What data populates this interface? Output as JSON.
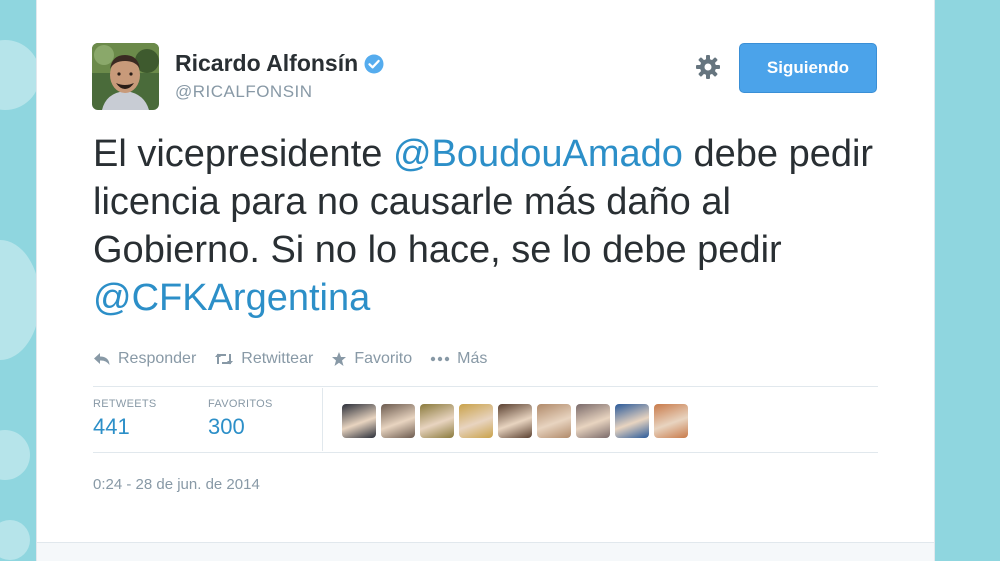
{
  "theme": {
    "accent": "#2c8fc8",
    "follow_button": "#4ba3ea",
    "background": "#8fd6df"
  },
  "tweet": {
    "author_name": "Ricardo Alfonsín",
    "author_handle": "@RICALFONSIN",
    "verified_icon": "verified-badge-icon",
    "settings_icon": "gear-icon",
    "follow_label": "Siguiendo",
    "text_parts": [
      "El vicepresidente ",
      "@BoudouAmado",
      " debe pedir licencia para no causarle más daño al Gobierno. Si no lo hace, se lo debe pedir ",
      "@CFKArgentina"
    ],
    "actions": [
      {
        "label": "Responder",
        "icon": "reply-icon"
      },
      {
        "label": "Retwittear",
        "icon": "retweet-icon"
      },
      {
        "label": "Favorito",
        "icon": "star-icon"
      },
      {
        "label": "Más",
        "icon": "more-icon"
      }
    ],
    "stats": {
      "retweets_label": "RETWEETS",
      "retweets_value": "441",
      "favorites_label": "FAVORITOS",
      "favorites_value": "300"
    },
    "favoriter_avatar_colors": [
      "#2b2f3a",
      "#6b5a4e",
      "#8a7a3c",
      "#c9a24a",
      "#5a4030",
      "#b08a6a",
      "#7a6a6a",
      "#2a5a9a",
      "#c87a4a"
    ],
    "timestamp": "0:24 - 28 de jun. de 2014"
  }
}
